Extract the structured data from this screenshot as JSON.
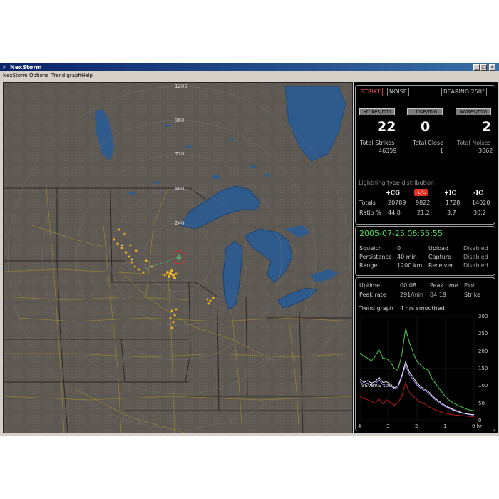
{
  "window": {
    "title": "NexStorm"
  },
  "menu": [
    "NexStorm",
    "Options",
    "Trend graph",
    "Help"
  ],
  "map": {
    "range_labels": [
      "1200",
      "960",
      "720",
      "480",
      "240"
    ]
  },
  "indicators": {
    "strike_label": "STRIKE",
    "noise_label": "NOISE",
    "bearing_label": "BEARING 250°"
  },
  "stats": {
    "strikes_btn": "Strikes/min",
    "close_btn": "Close/min",
    "noises_btn": "Noises/min",
    "strikes_value": "22",
    "close_value": "0",
    "noises_value": "2",
    "total_strikes_label": "Total Strikes",
    "total_strikes_value": "46359",
    "total_close_label": "Total Close",
    "total_close_value": "1",
    "total_noises_label": "Total Noises",
    "total_noises_value": "3062"
  },
  "distribution": {
    "title": "Lightning type distribution",
    "headers": [
      "+CG",
      "-CG",
      "+IC",
      "-IC"
    ],
    "rows": [
      {
        "label": "Totals",
        "values": [
          "20789",
          "9822",
          "1728",
          "14020"
        ]
      },
      {
        "label": "Ratio %",
        "values": [
          "44.8",
          "21.2",
          "3.7",
          "30.2"
        ]
      }
    ]
  },
  "status": {
    "datetime": "2005-07-25 06:55:55",
    "rows": [
      [
        "Squelch",
        "0",
        "Upload",
        "Disabled"
      ],
      [
        "Persistence",
        "40 min",
        "Capture",
        "Disabled"
      ],
      [
        "Range",
        "1200 km",
        "Receiver",
        "Disabled"
      ]
    ]
  },
  "trend": {
    "uptime_label": "Uptime",
    "uptime_value": "00:08",
    "peak_time_label": "Peak time",
    "plot_label": "Plot",
    "peak_rate_label": "Peak rate",
    "peak_rate_value": "291/min",
    "peak_time_value": "04:19",
    "plot_value": "Strike",
    "graph_label": "Trend graph",
    "graph_mode": "4 hrs smoothed",
    "severe_label": "SEVERE 100",
    "y_ticks": [
      "300",
      "250",
      "200",
      "150",
      "100",
      "50",
      "0"
    ],
    "x_ticks": [
      "4",
      "3",
      "2",
      "1",
      "0 hr"
    ],
    "colors": {
      "green": "#4cd04c",
      "red": "#c01818",
      "white": "#e8e8f8",
      "violet": "#a88cf0"
    },
    "series_green": [
      195,
      185,
      180,
      172,
      185,
      205,
      180,
      178,
      170,
      150,
      145,
      190,
      265,
      225,
      195,
      170,
      160,
      150,
      145,
      120,
      105,
      90,
      75,
      62,
      55,
      48,
      42,
      38,
      33,
      30,
      28
    ],
    "series_white": [
      120,
      110,
      115,
      108,
      112,
      125,
      110,
      112,
      105,
      95,
      100,
      130,
      170,
      140,
      125,
      108,
      98,
      90,
      84,
      72,
      62,
      54,
      46,
      40,
      35,
      30,
      26,
      22,
      20,
      18,
      17
    ],
    "series_violet": [
      112,
      104,
      108,
      102,
      105,
      118,
      104,
      106,
      100,
      92,
      96,
      126,
      160,
      132,
      118,
      102,
      93,
      86,
      80,
      68,
      58,
      50,
      43,
      37,
      32,
      28,
      24,
      21,
      19,
      17,
      16
    ],
    "series_red": [
      70,
      64,
      60,
      55,
      50,
      62,
      48,
      60,
      52,
      44,
      52,
      70,
      110,
      80,
      70,
      60,
      52,
      48,
      40,
      35,
      30,
      26,
      22,
      20,
      18,
      16,
      15,
      14,
      13,
      12,
      12
    ]
  }
}
